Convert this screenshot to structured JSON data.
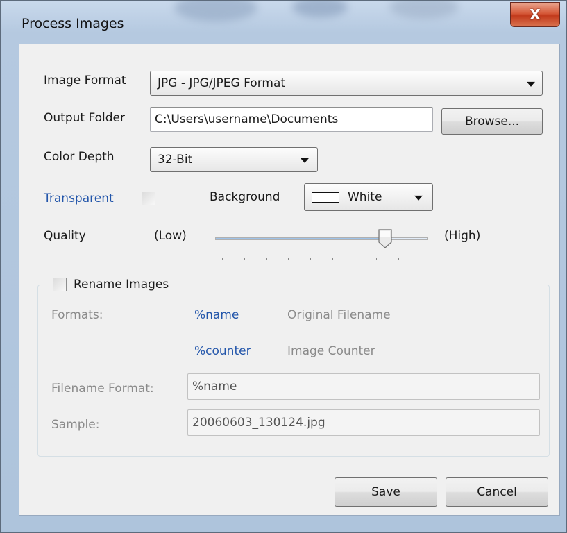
{
  "window": {
    "title": "Process Images",
    "close_glyph": "X"
  },
  "form": {
    "image_format": {
      "label": "Image Format",
      "selected": "JPG - JPG/JPEG Format"
    },
    "output_folder": {
      "label": "Output Folder",
      "value": "C:\\Users\\username\\Documents",
      "browse_label": "Browse..."
    },
    "color_depth": {
      "label": "Color Depth",
      "selected": "32-Bit"
    },
    "transparent": {
      "label": "Transparent",
      "checked": false
    },
    "background": {
      "label": "Background",
      "selected": "White",
      "swatch_color": "#ffffff"
    },
    "quality": {
      "label": "Quality",
      "low_label": "(Low)",
      "high_label": "(High)",
      "value_fraction": 0.8,
      "tick_count": 10
    }
  },
  "rename": {
    "checkbox_label": "Rename Images",
    "checked": false,
    "formats_label": "Formats:",
    "formats": [
      {
        "token": "%name",
        "description": "Original Filename"
      },
      {
        "token": "%counter",
        "description": "Image Counter"
      }
    ],
    "filename_format": {
      "label": "Filename Format:",
      "value": "%name"
    },
    "sample": {
      "label": "Sample:",
      "value": "20060603_130124.jpg"
    }
  },
  "buttons": {
    "save": "Save",
    "cancel": "Cancel"
  },
  "colors": {
    "link": "#2255aa",
    "disabled_text": "#8a8a8a",
    "close_red": "#c23a1c"
  }
}
